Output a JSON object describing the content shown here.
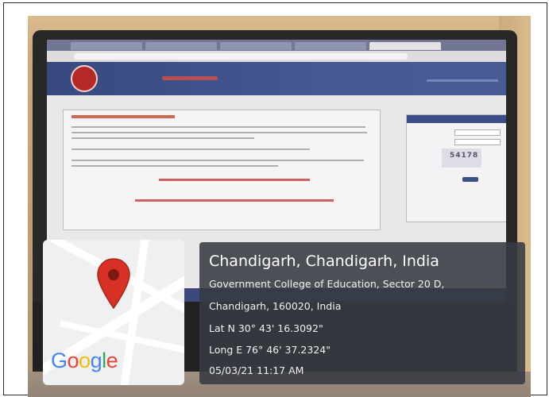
{
  "overlay": {
    "location_title": "Chandigarh, Chandigarh, India",
    "address_line1": "Government College of Education, Sector 20 D,",
    "address_line2": "Chandigarh, 160020, India",
    "latitude": "Lat N 30° 43' 16.3092\"",
    "longitude": "Long E 76° 46' 37.2324\"",
    "datetime": "05/03/21 11:17 AM"
  },
  "map_card": {
    "brand": "Google",
    "icon": "map-pin-icon",
    "brand_colors": [
      "#4285F4",
      "#EA4335",
      "#FBBC05",
      "#4285F4",
      "#34A853",
      "#EA4335"
    ]
  },
  "screen": {
    "captcha_text": "54178"
  },
  "colors": {
    "pin": "#d93025",
    "overlay_bg": "#373a42",
    "site_header": "#2b3f79"
  }
}
